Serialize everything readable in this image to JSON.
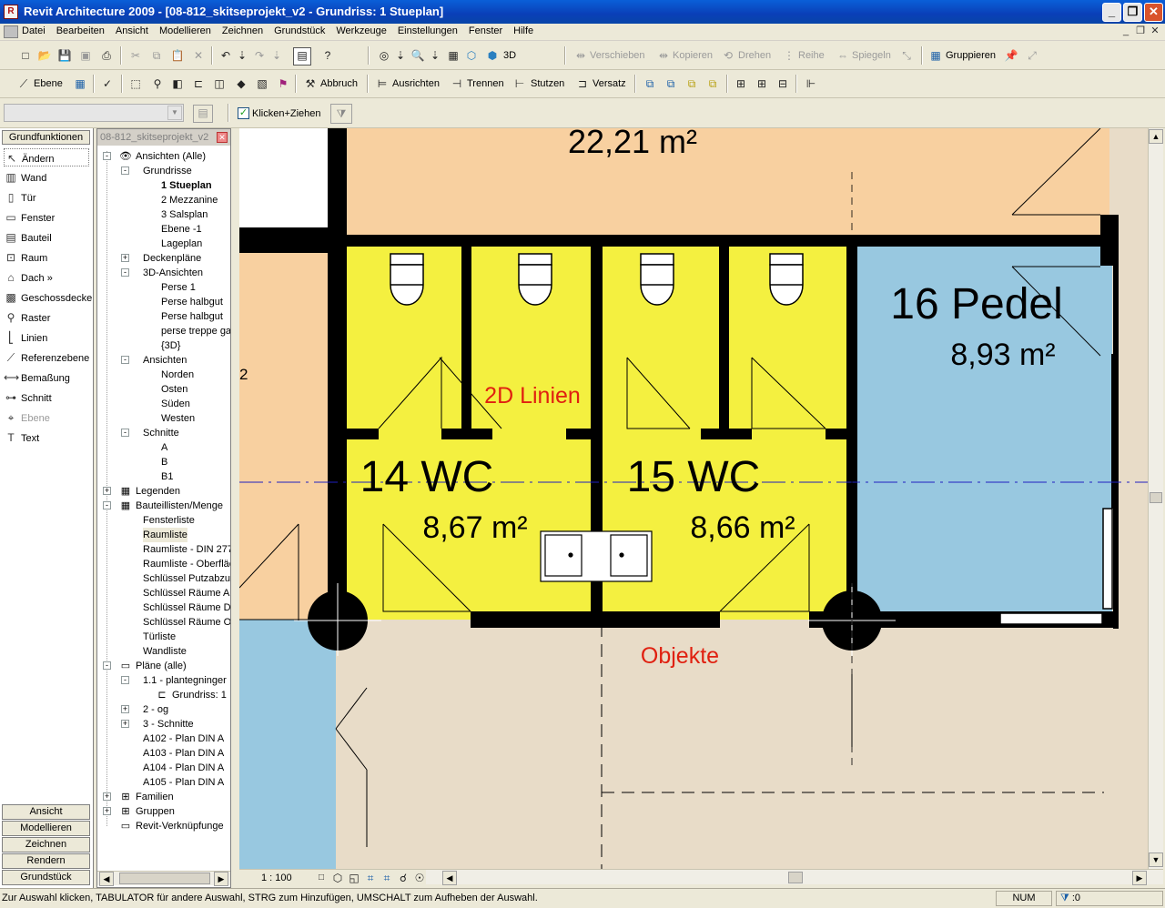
{
  "window": {
    "title": "Revit Architecture 2009 - [08-812_skitseprojekt_v2 - Grundriss: 1 Stueplan]"
  },
  "menu": [
    "Datei",
    "Bearbeiten",
    "Ansicht",
    "Modellieren",
    "Zeichnen",
    "Grundstück",
    "Werkzeuge",
    "Einstellungen",
    "Fenster",
    "Hilfe"
  ],
  "toolbar1": {
    "view3d_label": "3D",
    "move_label": "Verschieben",
    "copy_label": "Kopieren",
    "rotate_label": "Drehen",
    "array_label": "Reihe",
    "mirror_label": "Spiegeln",
    "group_label": "Gruppieren"
  },
  "toolbar2": {
    "level_label": "Ebene",
    "demolish_label": "Abbruch",
    "align_label": "Ausrichten",
    "split_label": "Trennen",
    "trim_label": "Stutzen",
    "offset_label": "Versatz"
  },
  "options": {
    "drag_label": "Klicken+Ziehen",
    "drag_checked": true
  },
  "designbar": {
    "header": "Grundfunktionen",
    "items": [
      {
        "label": "Ändern",
        "icon": "pointer-icon"
      },
      {
        "label": "Wand",
        "icon": "wall-icon"
      },
      {
        "label": "Tür",
        "icon": "door-icon"
      },
      {
        "label": "Fenster",
        "icon": "window-icon"
      },
      {
        "label": "Bauteil",
        "icon": "component-icon"
      },
      {
        "label": "Raum",
        "icon": "room-icon"
      },
      {
        "label": "Dach »",
        "icon": "roof-icon"
      },
      {
        "label": "Geschossdecke",
        "icon": "floor-icon"
      },
      {
        "label": "Raster",
        "icon": "grid-icon"
      },
      {
        "label": "Linien",
        "icon": "lines-icon"
      },
      {
        "label": "Referenzebene",
        "icon": "refplane-icon"
      },
      {
        "label": "Bemaßung",
        "icon": "dimension-icon"
      },
      {
        "label": "Schnitt",
        "icon": "section-icon"
      },
      {
        "label": "Ebene",
        "icon": "level-icon"
      },
      {
        "label": "Text",
        "icon": "text-icon"
      }
    ],
    "tabs": [
      "Ansicht",
      "Modellieren",
      "Zeichnen",
      "Rendern",
      "Grundstück"
    ]
  },
  "browser": {
    "title": "08-812_skitseprojekt_v2",
    "nodes": [
      {
        "label": "Ansichten (Alle)",
        "level": 0,
        "expander": "-",
        "icon": "eye-icon"
      },
      {
        "label": "Grundrisse",
        "level": 1,
        "expander": "-"
      },
      {
        "label": "1 Stueplan",
        "level": 2,
        "bold": true
      },
      {
        "label": "2 Mezzanine",
        "level": 2
      },
      {
        "label": "3 Salsplan",
        "level": 2
      },
      {
        "label": "Ebene -1",
        "level": 2
      },
      {
        "label": "Lageplan",
        "level": 2
      },
      {
        "label": "Deckenpläne",
        "level": 1,
        "expander": "+"
      },
      {
        "label": "3D-Ansichten",
        "level": 1,
        "expander": "-"
      },
      {
        "label": "Perse 1",
        "level": 2
      },
      {
        "label": "Perse halbgut",
        "level": 2
      },
      {
        "label": "Perse halbgut",
        "level": 2
      },
      {
        "label": "perse treppe ga",
        "level": 2
      },
      {
        "label": "{3D}",
        "level": 2
      },
      {
        "label": "Ansichten",
        "level": 1,
        "expander": "-"
      },
      {
        "label": "Norden",
        "level": 2
      },
      {
        "label": "Osten",
        "level": 2
      },
      {
        "label": "Süden",
        "level": 2
      },
      {
        "label": "Westen",
        "level": 2
      },
      {
        "label": "Schnitte",
        "level": 1,
        "expander": "-"
      },
      {
        "label": "A",
        "level": 2
      },
      {
        "label": "B",
        "level": 2
      },
      {
        "label": "B1",
        "level": 2
      },
      {
        "label": "Legenden",
        "level": 0,
        "expander": "+",
        "icon": "legend-icon"
      },
      {
        "label": "Bauteillisten/Menge",
        "level": 0,
        "expander": "-",
        "icon": "schedule-icon"
      },
      {
        "label": "Fensterliste",
        "level": 1
      },
      {
        "label": "Raumliste",
        "level": 1,
        "selected": true
      },
      {
        "label": "Raumliste - DIN 277",
        "level": 1
      },
      {
        "label": "Raumliste - Oberfläc",
        "level": 1
      },
      {
        "label": "Schlüssel Putzabzu",
        "level": 1
      },
      {
        "label": "Schlüssel Räume Ar",
        "level": 1
      },
      {
        "label": "Schlüssel Räume D",
        "level": 1
      },
      {
        "label": "Schlüssel Räume O",
        "level": 1
      },
      {
        "label": "Türliste",
        "level": 1
      },
      {
        "label": "Wandliste",
        "level": 1
      },
      {
        "label": "Pläne (alle)",
        "level": 0,
        "expander": "-",
        "icon": "sheet-icon"
      },
      {
        "label": "1.1 - plantegninger",
        "level": 1,
        "expander": "-"
      },
      {
        "label": "Grundriss: 1",
        "level": 2,
        "icon": "viewport-icon"
      },
      {
        "label": "2 - og",
        "level": 1,
        "expander": "+"
      },
      {
        "label": "3 - Schnitte",
        "level": 1,
        "expander": "+"
      },
      {
        "label": "A102 - Plan DIN A",
        "level": 1
      },
      {
        "label": "A103 - Plan DIN A",
        "level": 1
      },
      {
        "label": "A104 - Plan DIN A",
        "level": 1
      },
      {
        "label": "A105 - Plan DIN A",
        "level": 1
      },
      {
        "label": "Familien",
        "level": 0,
        "expander": "+",
        "icon": "family-icon"
      },
      {
        "label": "Gruppen",
        "level": 0,
        "expander": "+",
        "icon": "group-icon"
      },
      {
        "label": "Revit-Verknüpfunge",
        "level": 0,
        "icon": "link-icon"
      }
    ]
  },
  "drawing": {
    "area_top": "22,21 m²",
    "room14_name": "14 WC",
    "room14_area": "8,67 m²",
    "room15_name": "15 WC",
    "room15_area": "8,66 m²",
    "room16_name": "16 Pedel",
    "room16_area": "8,93 m²",
    "annotation_2d": "2D Linien",
    "annotation_objects": "Objekte",
    "edge_tag": "2",
    "colors": {
      "peach": "#f8d0a0",
      "yellow": "#f4f040",
      "blue": "#98c8e0",
      "beige": "#e8dcc8",
      "annotation_red": "#e02010"
    }
  },
  "viewbar": {
    "scale": "1 : 100"
  },
  "status": {
    "message": "Zur Auswahl klicken, TABULATOR für andere Auswahl, STRG zum Hinzufügen, UMSCHALT zum Aufheben der Auswahl.",
    "num": "NUM",
    "filter": ":0"
  }
}
